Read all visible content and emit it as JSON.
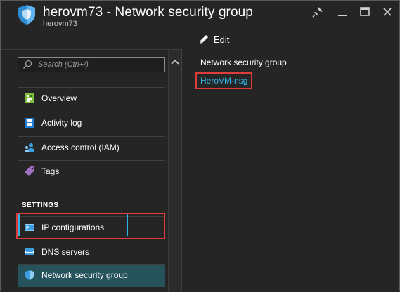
{
  "header": {
    "title": "herovm73 - Network security group",
    "subtitle": "herovm73",
    "app_icon": "shield-icon",
    "window_controls": [
      "pin-icon",
      "minimize-icon",
      "maximize-icon",
      "close-icon"
    ]
  },
  "command_bar": {
    "edit_label": "Edit",
    "edit_icon": "pencil-icon"
  },
  "search": {
    "placeholder": "Search (Ctrl+/)"
  },
  "menu": {
    "items": [
      {
        "label": "Overview",
        "icon": "overview-icon"
      },
      {
        "label": "Activity log",
        "icon": "activity-log-icon"
      },
      {
        "label": "Access control (IAM)",
        "icon": "access-control-icon"
      },
      {
        "label": "Tags",
        "icon": "tag-icon"
      }
    ],
    "settings_header": "SETTINGS",
    "settings_items": [
      {
        "label": "IP configurations",
        "icon": "ip-configurations-icon"
      },
      {
        "label": "DNS servers",
        "icon": "dns-servers-icon"
      },
      {
        "label": "Network security group",
        "icon": "shield-icon",
        "selected": true
      }
    ]
  },
  "content": {
    "field_label": "Network security group",
    "nsg_link": "HeroVM-nsg"
  },
  "colors": {
    "background": "#252526",
    "accent": "#32b6e8",
    "highlight_border": "#e03c3c",
    "selected_bg": "#26525b"
  }
}
